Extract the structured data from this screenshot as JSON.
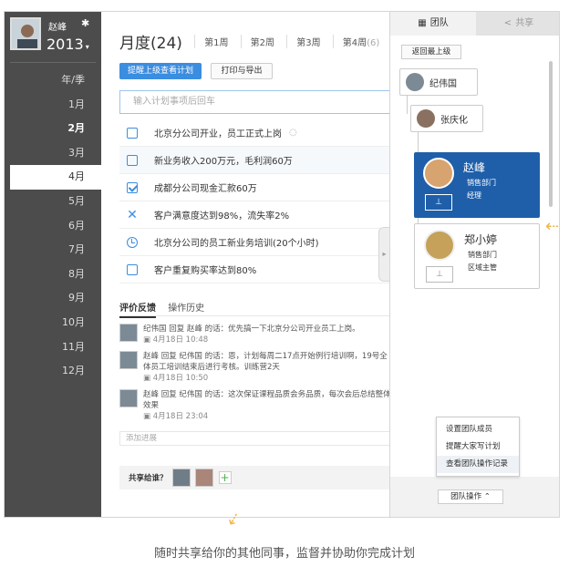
{
  "sidebar": {
    "user_name": "赵峰",
    "year": "2013",
    "section_label": "年/季",
    "months": [
      {
        "label": "1月",
        "bold": false,
        "active": false
      },
      {
        "label": "2月",
        "bold": true,
        "active": false
      },
      {
        "label": "3月",
        "bold": false,
        "active": false
      },
      {
        "label": "4月",
        "bold": false,
        "active": true
      },
      {
        "label": "5月",
        "bold": false,
        "active": false
      },
      {
        "label": "6月",
        "bold": false,
        "active": false
      },
      {
        "label": "7月",
        "bold": false,
        "active": false
      },
      {
        "label": "8月",
        "bold": false,
        "active": false
      },
      {
        "label": "9月",
        "bold": false,
        "active": false
      },
      {
        "label": "10月",
        "bold": false,
        "active": false
      },
      {
        "label": "11月",
        "bold": false,
        "active": false
      },
      {
        "label": "12月",
        "bold": false,
        "active": false
      }
    ]
  },
  "header": {
    "title": "月度(24)",
    "weeks": [
      "第1周",
      "第2周",
      "第3周",
      "第4周"
    ],
    "week4_count": "(6)"
  },
  "toolbar": {
    "remind_label": "提醒上级查看计划",
    "print_label": "打印与导出"
  },
  "plan_input": {
    "placeholder": "输入计划事项后回车"
  },
  "tasks": [
    {
      "status": "unchecked",
      "text": "北京分公司开业，员工正式上岗",
      "comment": true
    },
    {
      "status": "unchecked",
      "text": "新业务收入200万元，毛利润60万",
      "comment": false
    },
    {
      "status": "checked",
      "text": "成都分公司现金汇款60万",
      "comment": false
    },
    {
      "status": "failed",
      "text": "客户满意度达到98%，流失率2%",
      "comment": false
    },
    {
      "status": "pending",
      "text": "北京分公司的员工新业务培训(20个小时)",
      "comment": false
    },
    {
      "status": "unchecked",
      "text": "客户重复购买率达到80%",
      "comment": false
    }
  ],
  "feedback": {
    "tabs": [
      "评价反馈",
      "操作历史"
    ],
    "items": [
      {
        "text": "纪伟国  回复  赵峰  的话：优先搞一下北京分公司开业员工上岗。",
        "date": "4月18日  10:48"
      },
      {
        "text": "赵峰  回复  纪伟国  的话：恩，计划每周二17点开始例行培训啊，19号全体员工培训结束后进行考核。训练营2天",
        "date": "4月18日  10:50"
      },
      {
        "text": "赵峰  回复  纪伟国  的话：这次保证课程品质会务品质，每次会后总结整体效果",
        "date": "4月18日  23:04"
      }
    ],
    "add_placeholder": "添加进展"
  },
  "share": {
    "label": "共享给谁？"
  },
  "panel": {
    "tabs": [
      "团队",
      "共享"
    ],
    "back_label": "返回最上级",
    "nodes": [
      "纪伟国",
      "张庆化"
    ],
    "cards": [
      {
        "name": "赵峰",
        "dept": "销售部门",
        "position": "经理",
        "selected": true
      },
      {
        "name": "郑小婷",
        "dept": "销售部门",
        "position": "区域主管",
        "selected": false
      }
    ],
    "menu": [
      "设置团队成员",
      "提醒大家写计划",
      "查看团队操作记录"
    ],
    "team_op_label": "团队操作"
  },
  "caption": "随时共享给你的其他同事，监督并协助你完成计划",
  "colors": {
    "accent": "#3b8de0",
    "sidebar_bg": "#4c4c4c",
    "selected_card": "#1f5faa",
    "arrow": "#f0b64f"
  },
  "icons": [
    "gear-icon",
    "caret-down-icon",
    "comment-icon",
    "checkbox-icon",
    "x-icon",
    "clock-icon",
    "lock-icon",
    "add-icon",
    "team-icon",
    "share-icon",
    "org-chart-icon",
    "chevron-up-icon",
    "chevron-right-icon",
    "decorative-arrow-icon"
  ]
}
